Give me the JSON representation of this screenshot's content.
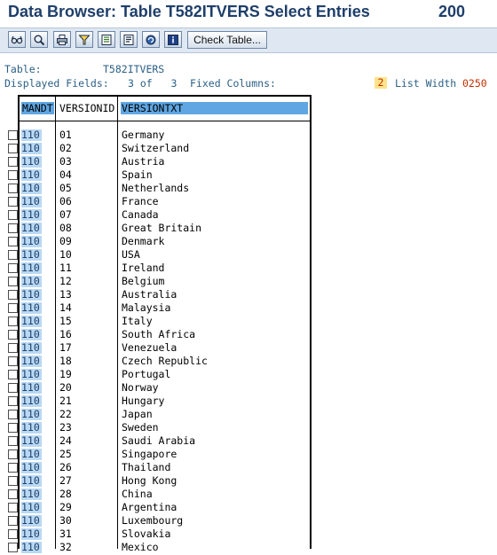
{
  "window": {
    "title": "Data Browser: Table T582ITVERS Select Entries",
    "entries_count": "200"
  },
  "toolbar": {
    "icons": [
      "glasses-icon",
      "magnifier-icon",
      "printer-icon",
      "filter-icon",
      "export-icon",
      "layout-icon",
      "refresh-icon",
      "info-icon"
    ],
    "check_table_label": "Check Table..."
  },
  "info": {
    "table_label": "Table:",
    "table_name": "T582ITVERS",
    "displayed_fields_label": "Displayed Fields:",
    "displayed_fields_value": "3 of   3",
    "fixed_columns_label": "Fixed Columns:",
    "fixed_columns_value": "2",
    "list_width_label": "List Width",
    "list_width_value": "0250"
  },
  "table": {
    "columns": [
      "MANDT",
      "VERSIONID",
      "VERSIONTXT"
    ],
    "rows": [
      [
        "110",
        "01",
        "Germany"
      ],
      [
        "110",
        "02",
        "Switzerland"
      ],
      [
        "110",
        "03",
        "Austria"
      ],
      [
        "110",
        "04",
        "Spain"
      ],
      [
        "110",
        "05",
        "Netherlands"
      ],
      [
        "110",
        "06",
        "France"
      ],
      [
        "110",
        "07",
        "Canada"
      ],
      [
        "110",
        "08",
        "Great Britain"
      ],
      [
        "110",
        "09",
        "Denmark"
      ],
      [
        "110",
        "10",
        "USA"
      ],
      [
        "110",
        "11",
        "Ireland"
      ],
      [
        "110",
        "12",
        "Belgium"
      ],
      [
        "110",
        "13",
        "Australia"
      ],
      [
        "110",
        "14",
        "Malaysia"
      ],
      [
        "110",
        "15",
        "Italy"
      ],
      [
        "110",
        "16",
        "South Africa"
      ],
      [
        "110",
        "17",
        "Venezuela"
      ],
      [
        "110",
        "18",
        "Czech Republic"
      ],
      [
        "110",
        "19",
        "Portugal"
      ],
      [
        "110",
        "20",
        "Norway"
      ],
      [
        "110",
        "21",
        "Hungary"
      ],
      [
        "110",
        "22",
        "Japan"
      ],
      [
        "110",
        "23",
        "Sweden"
      ],
      [
        "110",
        "24",
        "Saudi Arabia"
      ],
      [
        "110",
        "25",
        "Singapore"
      ],
      [
        "110",
        "26",
        "Thailand"
      ],
      [
        "110",
        "27",
        "Hong Kong"
      ],
      [
        "110",
        "28",
        "China"
      ],
      [
        "110",
        "29",
        "Argentina"
      ],
      [
        "110",
        "30",
        "Luxembourg"
      ],
      [
        "110",
        "31",
        "Slovakia"
      ],
      [
        "110",
        "32",
        "Mexico"
      ]
    ]
  }
}
